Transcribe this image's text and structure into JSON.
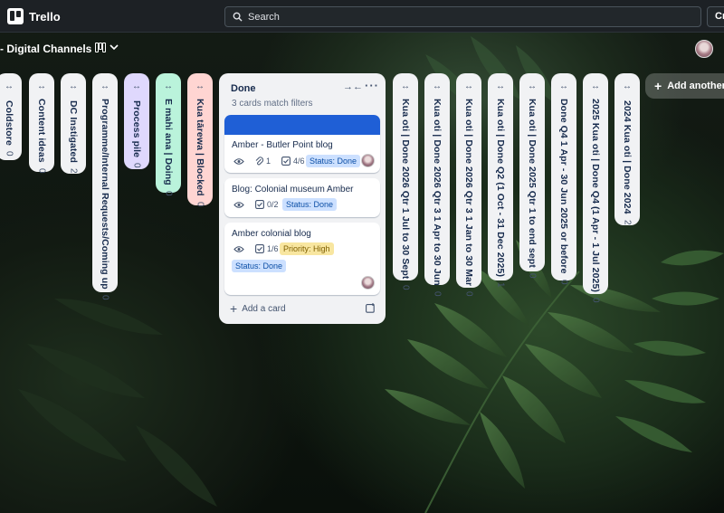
{
  "app": {
    "name": "Trello"
  },
  "search": {
    "label": "Search"
  },
  "create": {
    "label": "Cr"
  },
  "board": {
    "title": "- Digital Channels"
  },
  "collapsed_left": [
    {
      "title": "Coldstore",
      "count": "0",
      "color": "#f1f2f4"
    },
    {
      "title": "Content ideas",
      "count": "0",
      "color": "#f1f2f4"
    },
    {
      "title": "DC Instigated",
      "count": "2",
      "color": "#f1f2f4"
    },
    {
      "title": "Programme/Internal Requests/Coming up",
      "count": "0",
      "color": "#f1f2f4"
    },
    {
      "title": "Process pile",
      "count": "0",
      "color": "#dfd8fd"
    },
    {
      "title": "E mahi ana | Doing",
      "count": "0",
      "color": "#baf3db"
    },
    {
      "title": "Kua tārewa | Blocked",
      "count": "0",
      "color": "#ffd5d2"
    }
  ],
  "done_list": {
    "title": "Done",
    "filter_note": "3 cards match filters",
    "add_card": "Add a card",
    "cards": [
      {
        "title": "Amber - Butler Point blog",
        "attachments": "1",
        "checklist": "4/6",
        "badges": [
          "Status: Done"
        ]
      },
      {
        "title": "Blog: Colonial museum Amber",
        "checklist": "0/2",
        "badges": [
          "Status: Done"
        ]
      },
      {
        "title": "Amber colonial blog",
        "checklist": "1/6",
        "badges": [
          "Priority: High",
          "Status: Done"
        ]
      }
    ]
  },
  "collapsed_right": [
    {
      "title": "Kua oti | Done 2026 Qtr 1 Jul to 30 Sept",
      "count": "0"
    },
    {
      "title": "Kua oti | Done 2026 Qtr 3 1 Apr to 30 Jun",
      "count": "0"
    },
    {
      "title": "Kua oti | Done 2026 Qtr 3 1 Jan to 30 Mar",
      "count": "0"
    },
    {
      "title": "Kua oti | Done Q2 (1 Oct - 31 Dec 2025)",
      "count": "1"
    },
    {
      "title": "Kua oti | Done 2025 Qtr 1 to end sept",
      "count": "0"
    },
    {
      "title": "Done Q4 1 Apr - 30 Jun 2025 or before",
      "count": "0"
    },
    {
      "title": "2025 Kua oti | Done Q4 (1 Apr - 1 Jul 2025)",
      "count": "0"
    },
    {
      "title": "2024 Kua oti | Done 2024",
      "count": "2"
    }
  ],
  "add_list": {
    "label": "Add another li"
  },
  "colors": {
    "topbar": "#1d2125",
    "cover": "#1f5fd6",
    "list_bg": "#f1f2f4"
  }
}
